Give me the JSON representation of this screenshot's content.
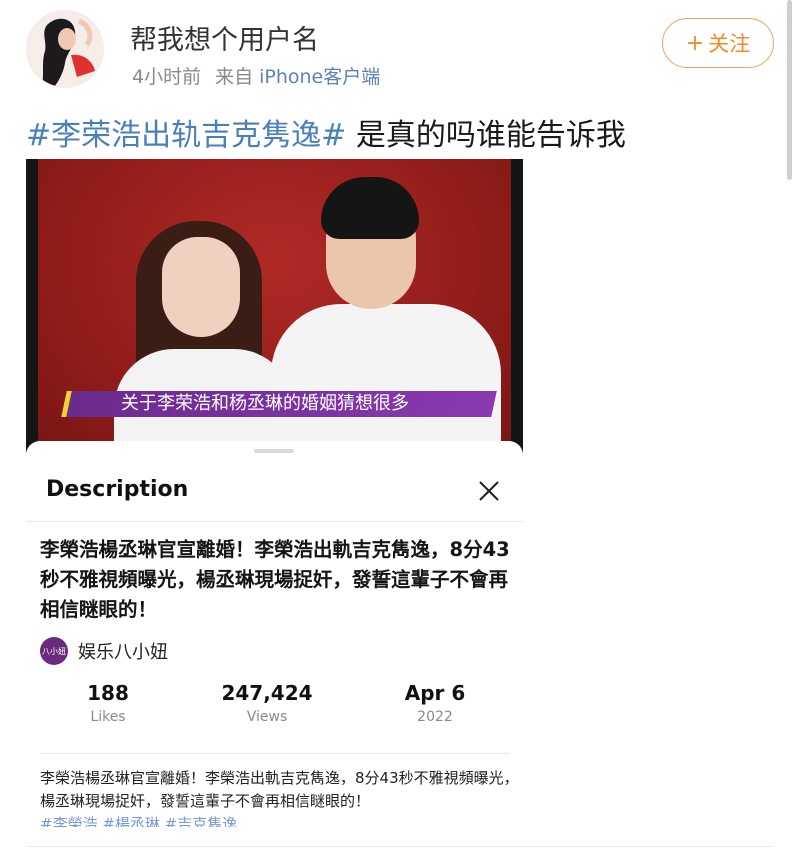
{
  "post": {
    "username": "帮我想个用户名",
    "time": "4小时前",
    "from_label": "来自",
    "client": "iPhone客户端",
    "follow_label": "关注",
    "topic": "#李荣浩出轨吉克隽逸#",
    "text": " 是真的吗谁能告诉我"
  },
  "video": {
    "subtitle": "关于李荣浩和杨丞琳的婚姻猜想很多"
  },
  "description": {
    "title": "Description",
    "headline": "李榮浩楊丞琳官宣離婚！李榮浩出軌吉克雋逸，8分43秒不雅視頻曝光，楊丞琳現場捉奸，發誓這輩子不會再相信瞇眼的！",
    "channel_name": "娱乐八小妞",
    "channel_avatar_text": "八小妞",
    "stats": {
      "likes_value": "188",
      "likes_label": "Likes",
      "views_value": "247,424",
      "views_label": "Views",
      "date_value": "Apr 6",
      "date_label": "2022"
    },
    "body": "李榮浩楊丞琳官宣離婚！李榮浩出軌吉克雋逸，8分43秒不雅視頻曝光，楊丞琳現場捉奸，發誓這輩子不會再相信瞇眼的！",
    "tags": "#李榮浩 #楊丞琳 #吉克雋逸"
  },
  "colors": {
    "topic": "#4a7fbf",
    "follow": "#f08a2c",
    "client": "#5b83b8"
  }
}
